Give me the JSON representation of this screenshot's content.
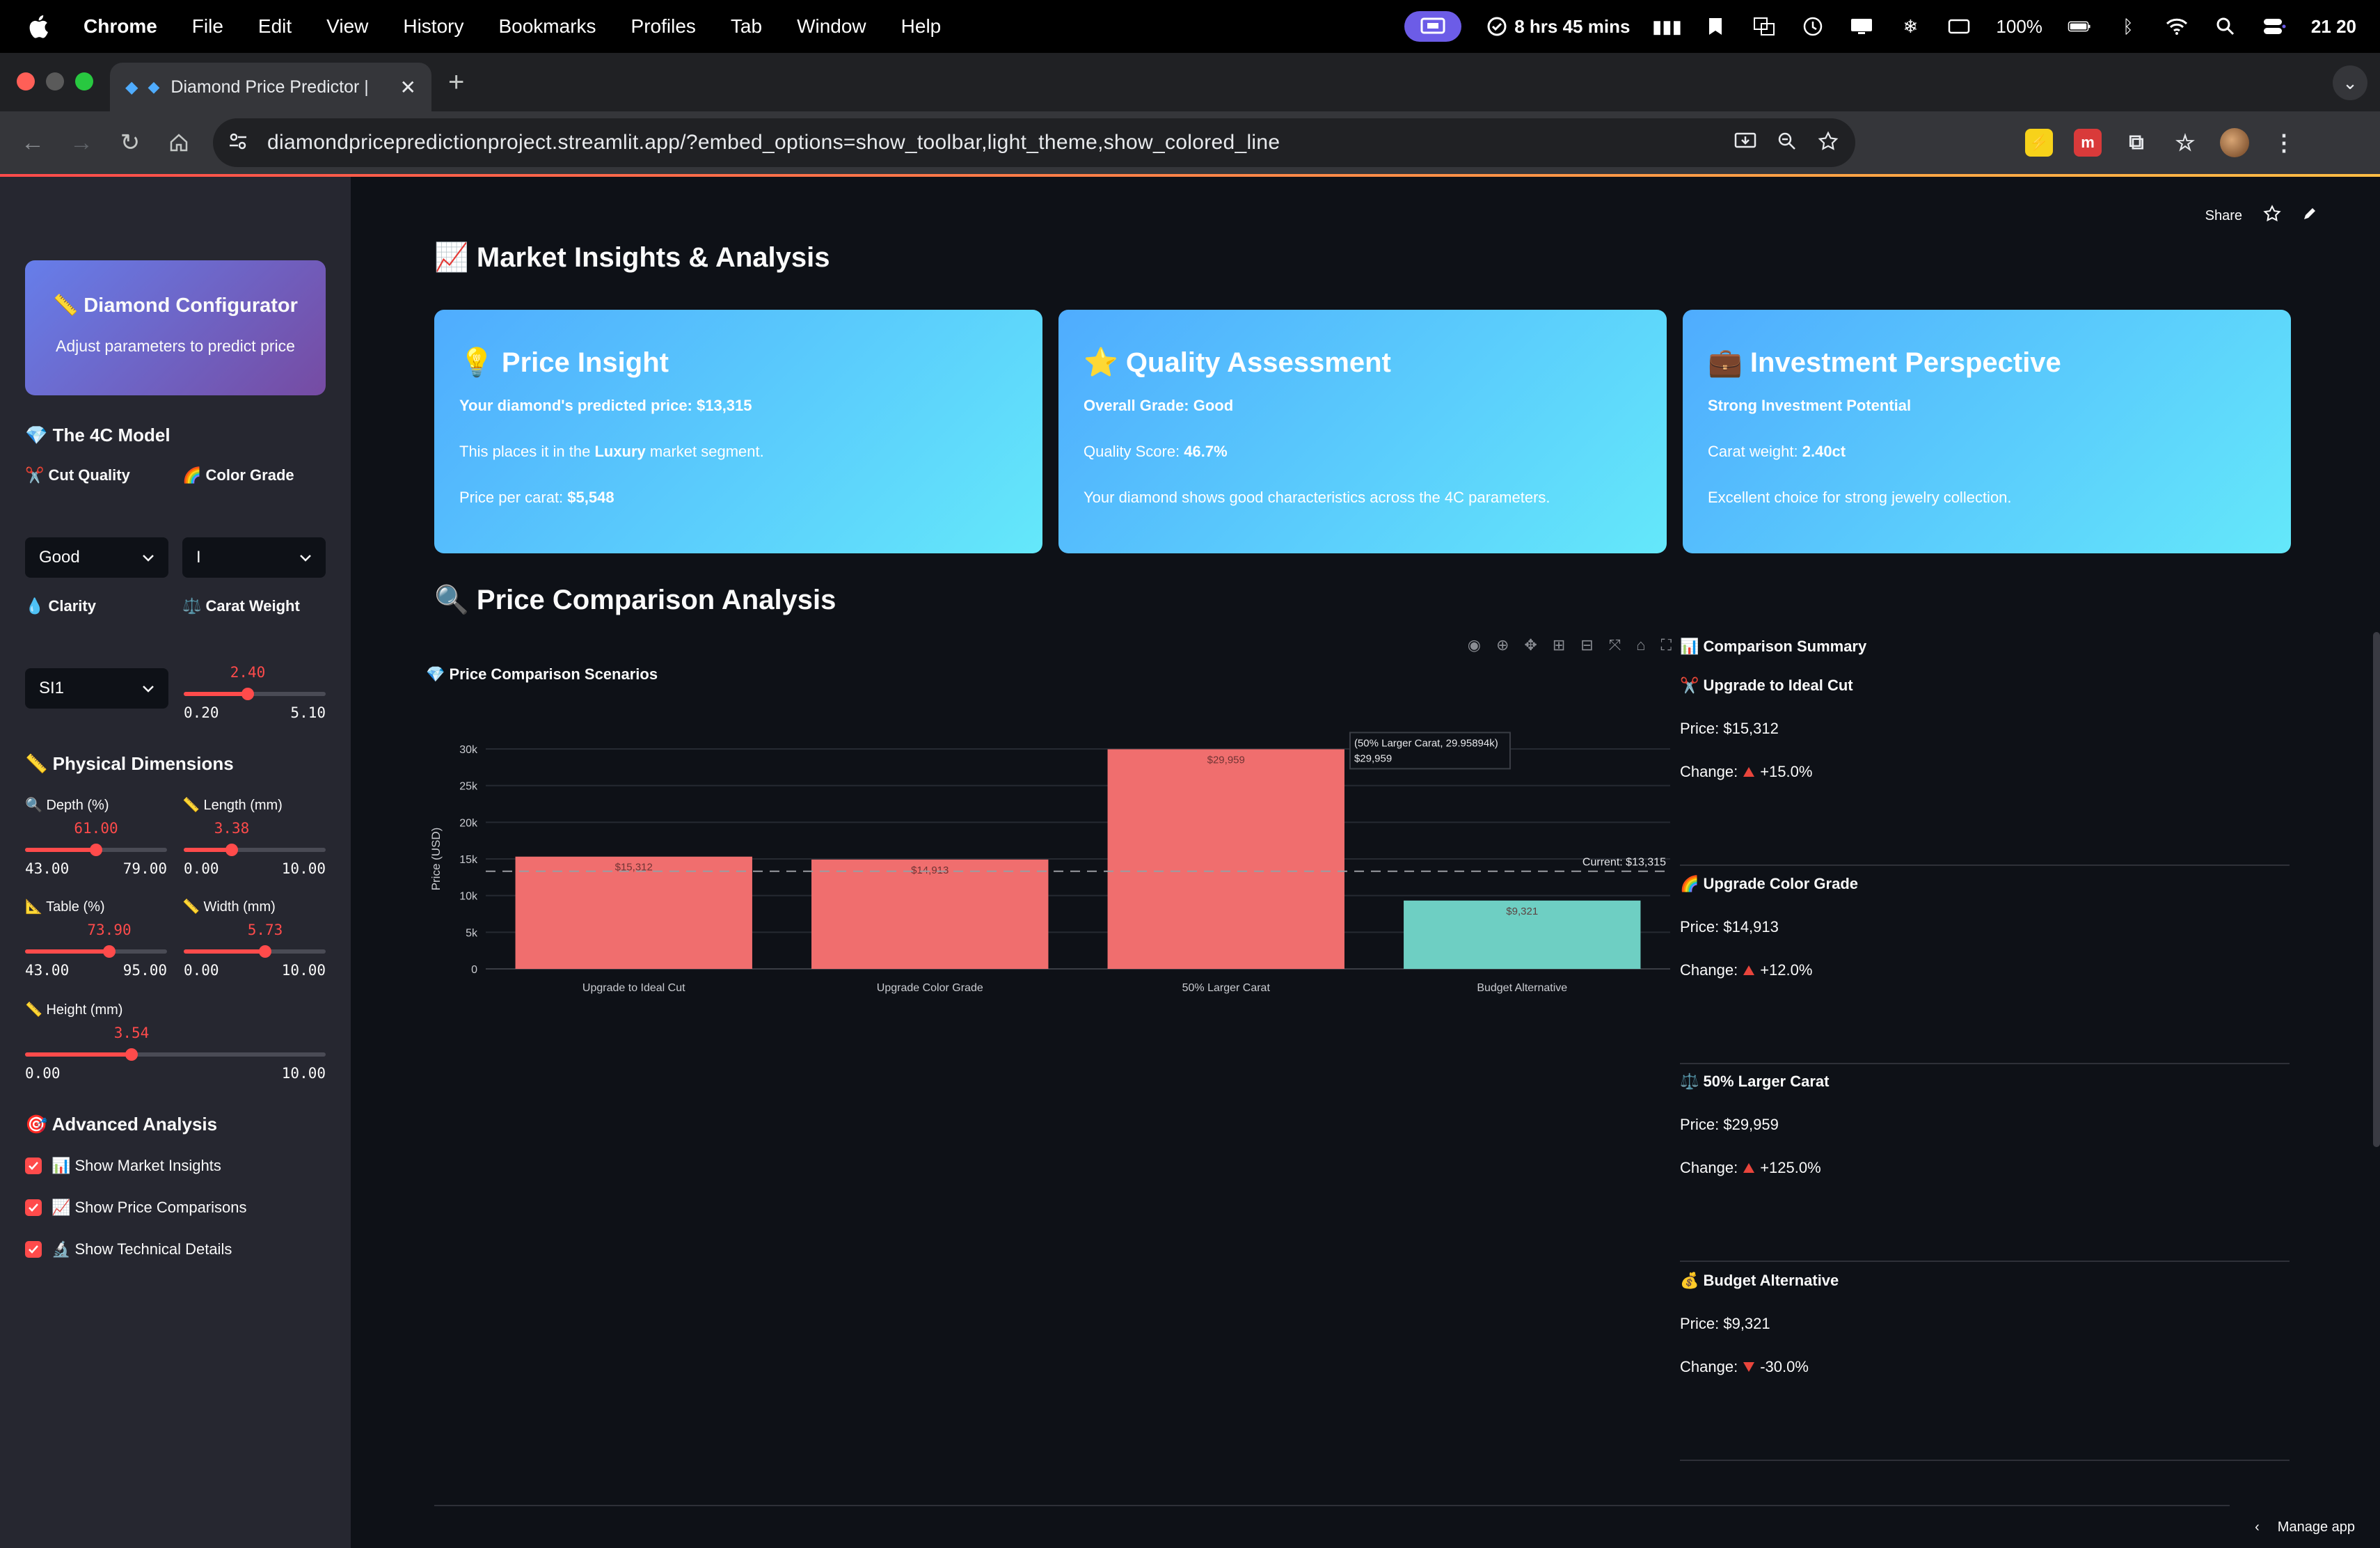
{
  "macbar": {
    "app": "Chrome",
    "menus": [
      "File",
      "Edit",
      "View",
      "History",
      "Bookmarks",
      "Profiles",
      "Tab",
      "Window",
      "Help"
    ],
    "focus_time": "8 hrs 45 mins",
    "battery": "100%",
    "clock": "21 20"
  },
  "browser": {
    "tab_title": "Diamond Price Predictor |",
    "url": "diamondpricepredictionproject.streamlit.app/?embed_options=show_toolbar,light_theme,show_colored_line"
  },
  "sidebar": {
    "config_title": "📏 Diamond Configurator",
    "config_subtitle": "Adjust parameters to predict price",
    "model_heading": "💎 The 4C Model",
    "cut_label": "✂️ Cut Quality",
    "color_label": "🌈 Color Grade",
    "cut_value": "Good",
    "color_value": "I",
    "clarity_label": "💧 Clarity",
    "carat_label": "⚖️ Carat Weight",
    "clarity_value": "SI1",
    "carat": {
      "value": "2.40",
      "min": "0.20",
      "max": "5.10",
      "level": 0.449
    },
    "dimensions_heading": "📏 Physical Dimensions",
    "depth": {
      "label": "🔍 Depth (%)",
      "value": "61.00",
      "min": "43.00",
      "max": "79.00",
      "level": 0.5
    },
    "length": {
      "label": "📏 Length (mm)",
      "value": "3.38",
      "min": "0.00",
      "max": "10.00",
      "level": 0.338
    },
    "table": {
      "label": "📐 Table (%)",
      "value": "73.90",
      "min": "43.00",
      "max": "95.00",
      "level": 0.594
    },
    "width": {
      "label": "📏 Width (mm)",
      "value": "5.73",
      "min": "0.00",
      "max": "10.00",
      "level": 0.573
    },
    "height": {
      "label": "📏 Height (mm)",
      "value": "3.54",
      "min": "0.00",
      "max": "10.00",
      "level": 0.354
    },
    "advanced_heading": "🎯 Advanced Analysis",
    "checks": [
      {
        "label": "📊 Show Market Insights"
      },
      {
        "label": "📈 Show Price Comparisons"
      },
      {
        "label": "🔬 Show Technical Details"
      }
    ]
  },
  "main": {
    "share": "Share",
    "insights_heading": "📈 Market Insights & Analysis",
    "card1": {
      "title": "💡 Price Insight",
      "l1": "Your diamond's predicted price: $13,315",
      "l2a": "This places it in the ",
      "l2b": "Luxury",
      "l2c": " market segment.",
      "l3a": "Price per carat: ",
      "l3b": "$5,548"
    },
    "card2": {
      "title": "⭐ Quality Assessment",
      "l1": "Overall Grade: Good",
      "l2a": "Quality Score: ",
      "l2b": "46.7%",
      "l3": "Your diamond shows good characteristics across the 4C parameters."
    },
    "card3": {
      "title": "💼 Investment Perspective",
      "l1": "Strong Investment Potential",
      "l2a": "Carat weight: ",
      "l2b": "2.40ct",
      "l3": "Excellent choice for strong jewelry collection."
    },
    "comparison_heading": "🔍 Price Comparison Analysis",
    "chart_heading": "💎 Price Comparison Scenarios",
    "summary_heading": "📊 Comparison Summary",
    "summary": [
      {
        "title": "✂️ Upgrade to Ideal Cut",
        "price": "Price: $15,312",
        "change_label": "Change:",
        "change": "+15.0%",
        "dir": "up"
      },
      {
        "title": "🌈 Upgrade Color Grade",
        "price": "Price: $14,913",
        "change_label": "Change:",
        "change": "+12.0%",
        "dir": "up"
      },
      {
        "title": "⚖️ 50% Larger Carat",
        "price": "Price: $29,959",
        "change_label": "Change:",
        "change": "+125.0%",
        "dir": "up"
      },
      {
        "title": "💰 Budget Alternative",
        "price": "Price: $9,321",
        "change_label": "Change:",
        "change": "-30.0%",
        "dir": "down"
      }
    ],
    "manage_app": "Manage app"
  },
  "chart_data": {
    "type": "bar",
    "title": "💎 Price Comparison Scenarios",
    "categories": [
      "Upgrade to Ideal Cut",
      "Upgrade Color Grade",
      "50% Larger Carat",
      "Budget Alternative"
    ],
    "values": [
      15312,
      14913,
      29959,
      9321
    ],
    "value_labels": [
      "$15,312",
      "$14,913",
      "$29,959",
      "$9,321"
    ],
    "bar_colors": [
      "#f06e6e",
      "#f06e6e",
      "#f06e6e",
      "#6ecfc3"
    ],
    "ylabel": "Price (USD)",
    "ylim": [
      0,
      30000
    ],
    "yticks": [
      0,
      5000,
      10000,
      15000,
      20000,
      25000,
      30000
    ],
    "ytick_labels": [
      "0",
      "5k",
      "10k",
      "15k",
      "20k",
      "25k",
      "30k"
    ],
    "reference_line": {
      "value": 13315,
      "label": "Current: $13,315"
    },
    "hover": {
      "title": "(50% Larger Carat, 29.95894k)",
      "value": "$29,959"
    },
    "grid": true
  }
}
